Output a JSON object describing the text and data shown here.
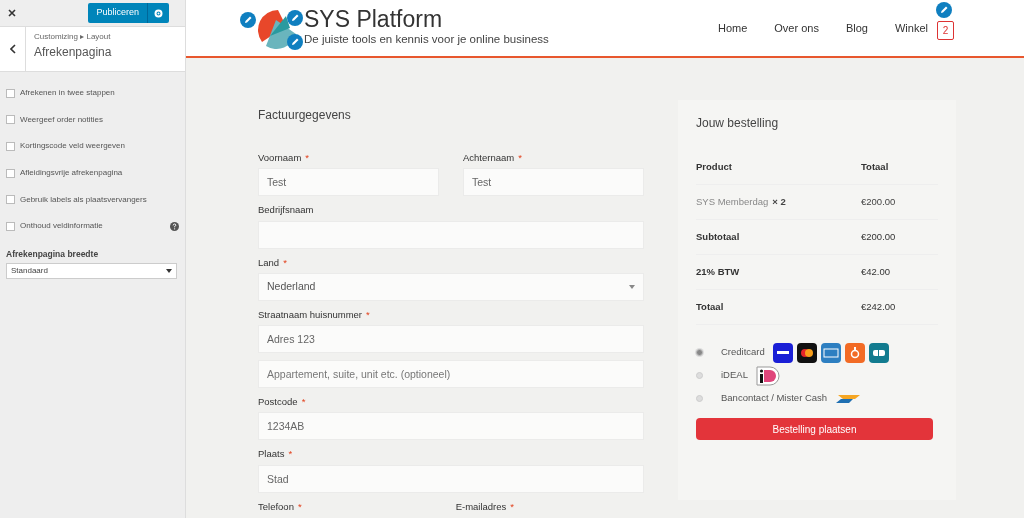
{
  "customizer": {
    "publish_button": "Publiceren",
    "breadcrumb": "Customizing ▸ Layout",
    "section_title": "Afrekenpagina",
    "options": [
      {
        "label": "Afrekenen in twee stappen",
        "checked": false,
        "help": false
      },
      {
        "label": "Weergeef order notities",
        "checked": false,
        "help": false
      },
      {
        "label": "Kortingscode veld weergeven",
        "checked": false,
        "help": false
      },
      {
        "label": "Afleidingsvrije afrekenpagina",
        "checked": false,
        "help": false
      },
      {
        "label": "Gebruik labels als plaatsvervangers",
        "checked": false,
        "help": false
      },
      {
        "label": "Onthoud veldinformatie",
        "checked": false,
        "help": true
      }
    ],
    "width_setting": {
      "label": "Afrekenpagina breedte",
      "value": "Standaard"
    }
  },
  "site": {
    "title": "SYS Platform",
    "tagline": "De juiste tools en kennis voor je online business",
    "nav": [
      "Home",
      "Over ons",
      "Blog",
      "Winkel"
    ],
    "cart_count": "2"
  },
  "billing": {
    "title": "Factuurgegevens",
    "required_mark": "*",
    "rows": [
      [
        {
          "kind": "input",
          "label": "Voornaam",
          "required": true,
          "value": "Test"
        },
        {
          "kind": "input",
          "label": "Achternaam",
          "required": true,
          "value": "Test"
        }
      ],
      [
        {
          "kind": "input",
          "label": "Bedrijfsnaam",
          "required": false
        }
      ],
      [
        {
          "kind": "select",
          "label": "Land",
          "required": true,
          "value": "Nederland"
        }
      ],
      [
        {
          "kind": "input",
          "label": "Straatnaam huisnummer",
          "required": true,
          "value": "Adres 123"
        }
      ],
      [
        {
          "kind": "input",
          "placeholder": "Appartement, suite, unit etc. (optioneel)"
        }
      ],
      [
        {
          "kind": "input",
          "label": "Postcode",
          "required": true,
          "value": "1234AB"
        }
      ],
      [
        {
          "kind": "input",
          "label": "Plaats",
          "required": true,
          "value": "Stad"
        }
      ],
      [
        {
          "kind": "label",
          "label": "Telefoon",
          "required": true
        },
        {
          "kind": "label",
          "label": "E-mailadres",
          "required": true
        }
      ]
    ]
  },
  "order": {
    "title": "Jouw bestelling",
    "columns": [
      "Product",
      "Totaal"
    ],
    "items": [
      {
        "name": "SYS Memberdag",
        "quantity": "× 2",
        "total": "€200.00"
      }
    ],
    "totals": [
      {
        "label": "Subtotaal",
        "value": "€200.00"
      },
      {
        "label": "21% BTW",
        "value": "€42.00"
      },
      {
        "label": "Totaal",
        "value": "€242.00"
      }
    ],
    "payment_methods": [
      {
        "label": "Creditcard",
        "selected": true,
        "kind": "cards"
      },
      {
        "label": "iDEAL",
        "selected": false,
        "kind": "ideal"
      },
      {
        "label": "Bancontact / Mister Cash",
        "selected": false,
        "kind": "bancontact"
      }
    ],
    "button": "Bestelling plaatsen"
  }
}
